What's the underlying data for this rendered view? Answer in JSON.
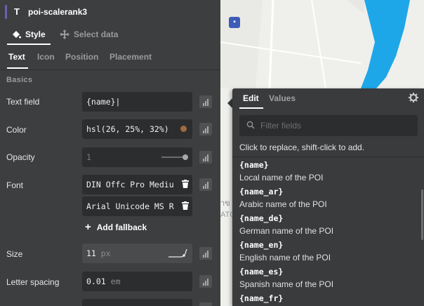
{
  "layer": {
    "type_icon": "T",
    "name": "poi-scalerank3"
  },
  "mode_tabs": [
    {
      "label": "Style",
      "icon": "paint-bucket-icon",
      "active": true
    },
    {
      "label": "Select data",
      "icon": "crosshair-icon",
      "active": false
    }
  ],
  "sub_tabs": [
    {
      "label": "Text",
      "active": true
    },
    {
      "label": "Icon",
      "active": false
    },
    {
      "label": "Position",
      "active": false
    },
    {
      "label": "Placement",
      "active": false
    }
  ],
  "section": {
    "title": "Basics"
  },
  "rows": {
    "text_field": {
      "label": "Text field",
      "value": "{name}|"
    },
    "color": {
      "label": "Color",
      "value": "hsl(26, 25%, 32%)",
      "swatch": "#a16a3e"
    },
    "opacity": {
      "label": "Opacity",
      "value": "1"
    },
    "font": {
      "label": "Font",
      "value_1": "DIN Offc Pro Mediu",
      "value_2": "Arial Unicode MS R"
    },
    "add_fallback": {
      "label": "Add fallback"
    },
    "size": {
      "label": "Size",
      "value": "11",
      "unit": "px"
    },
    "letter_spacing": {
      "label": "Letter spacing",
      "value": "0.01",
      "unit": "em"
    }
  },
  "popup": {
    "tabs": [
      {
        "label": "Edit",
        "active": true
      },
      {
        "label": "Values",
        "active": false
      }
    ],
    "filter_placeholder": "Filter fields",
    "hint": "Click to replace, shift-click to add.",
    "fields": [
      {
        "key": "{name}",
        "desc": "Local name of the POI"
      },
      {
        "key": "{name_ar}",
        "desc": "Arabic name of the POI"
      },
      {
        "key": "{name_de}",
        "desc": "German name of the POI"
      },
      {
        "key": "{name_en}",
        "desc": "English name of the POI"
      },
      {
        "key": "{name_es}",
        "desc": "Spanish name of the POI"
      },
      {
        "key": "{name_fr}",
        "desc": ""
      }
    ]
  },
  "map": {
    "label_1": "าข",
    "label_2": "ATC"
  },
  "colors": {
    "accent": "#6b5fb0",
    "water": "#1ea7e8",
    "panel": "#3d3e40",
    "field": "#2c2d2f"
  }
}
